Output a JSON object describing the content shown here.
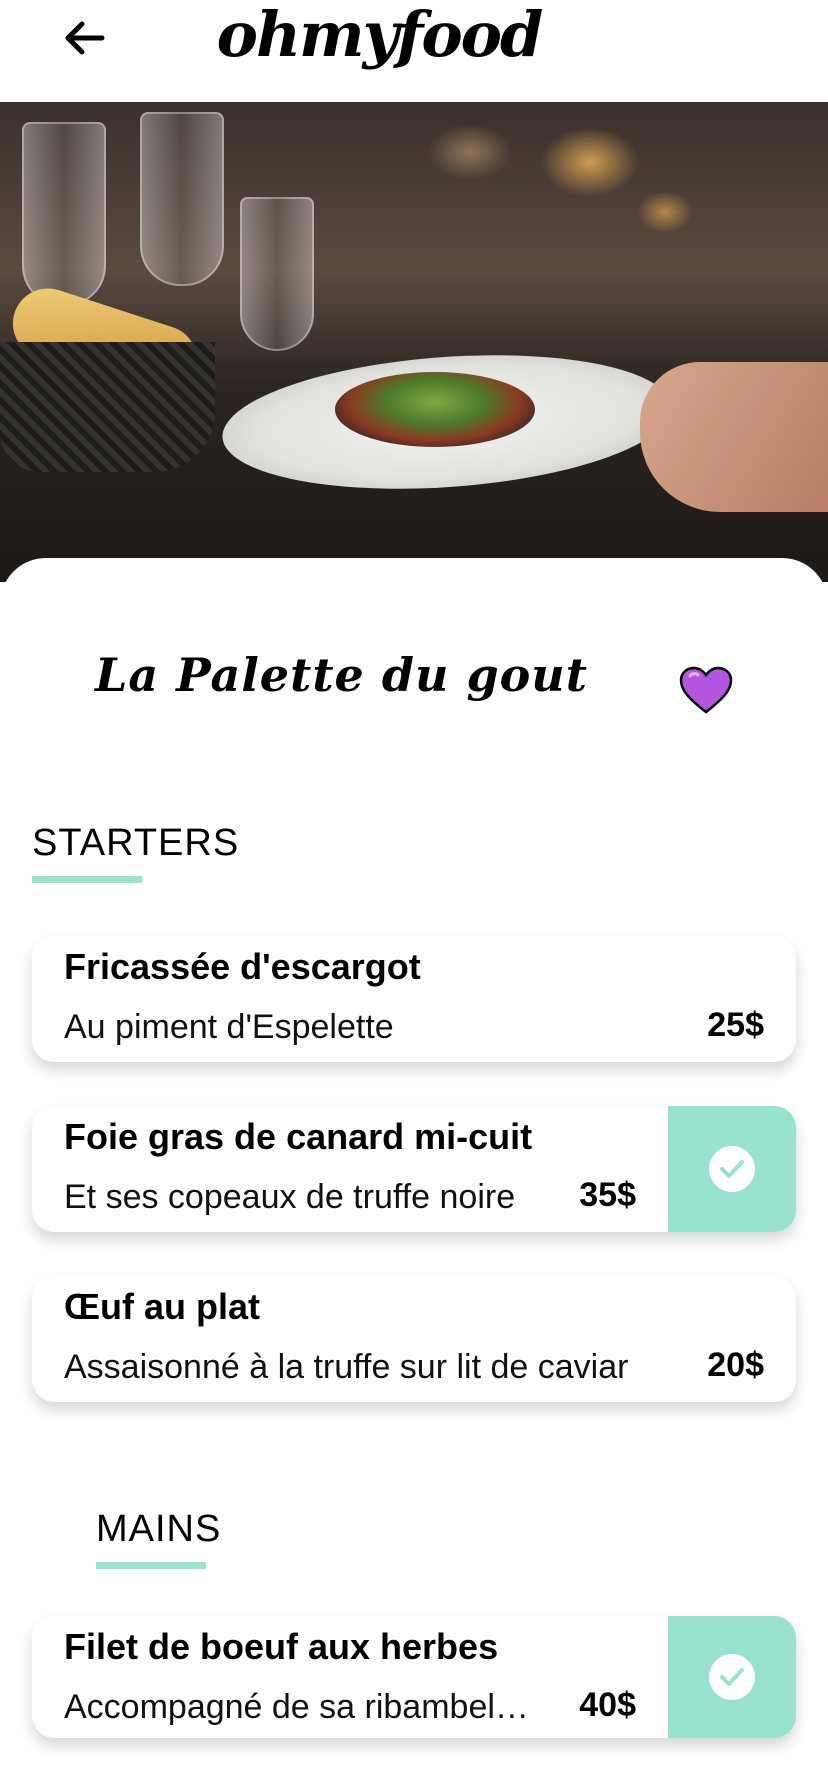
{
  "header": {
    "logo": "ohmyfood",
    "back_icon": "arrow-left-icon"
  },
  "restaurant": {
    "name": "La Palette du gout",
    "favorite_icon": "heart-icon",
    "favorite_color": "#b455e0"
  },
  "accent_color": "#99e2d0",
  "sections": [
    {
      "title": "STARTERS",
      "items": [
        {
          "name": "Fricassée d'escargot",
          "description": "Au piment d'Espelette",
          "price": "25$",
          "selected": false
        },
        {
          "name": "Foie gras de canard mi-cuit",
          "description": "Et ses copeaux de truffe noire",
          "price": "35$",
          "selected": true
        },
        {
          "name": "Œuf au plat",
          "description": "Assaisonné à la truffe sur lit de caviar",
          "price": "20$",
          "selected": false
        }
      ]
    },
    {
      "title": "MAINS",
      "items": [
        {
          "name": "Filet de boeuf aux herbes",
          "description": "Accompagné de sa ribambelle de légumes",
          "price": "40$",
          "selected": true
        }
      ]
    }
  ]
}
